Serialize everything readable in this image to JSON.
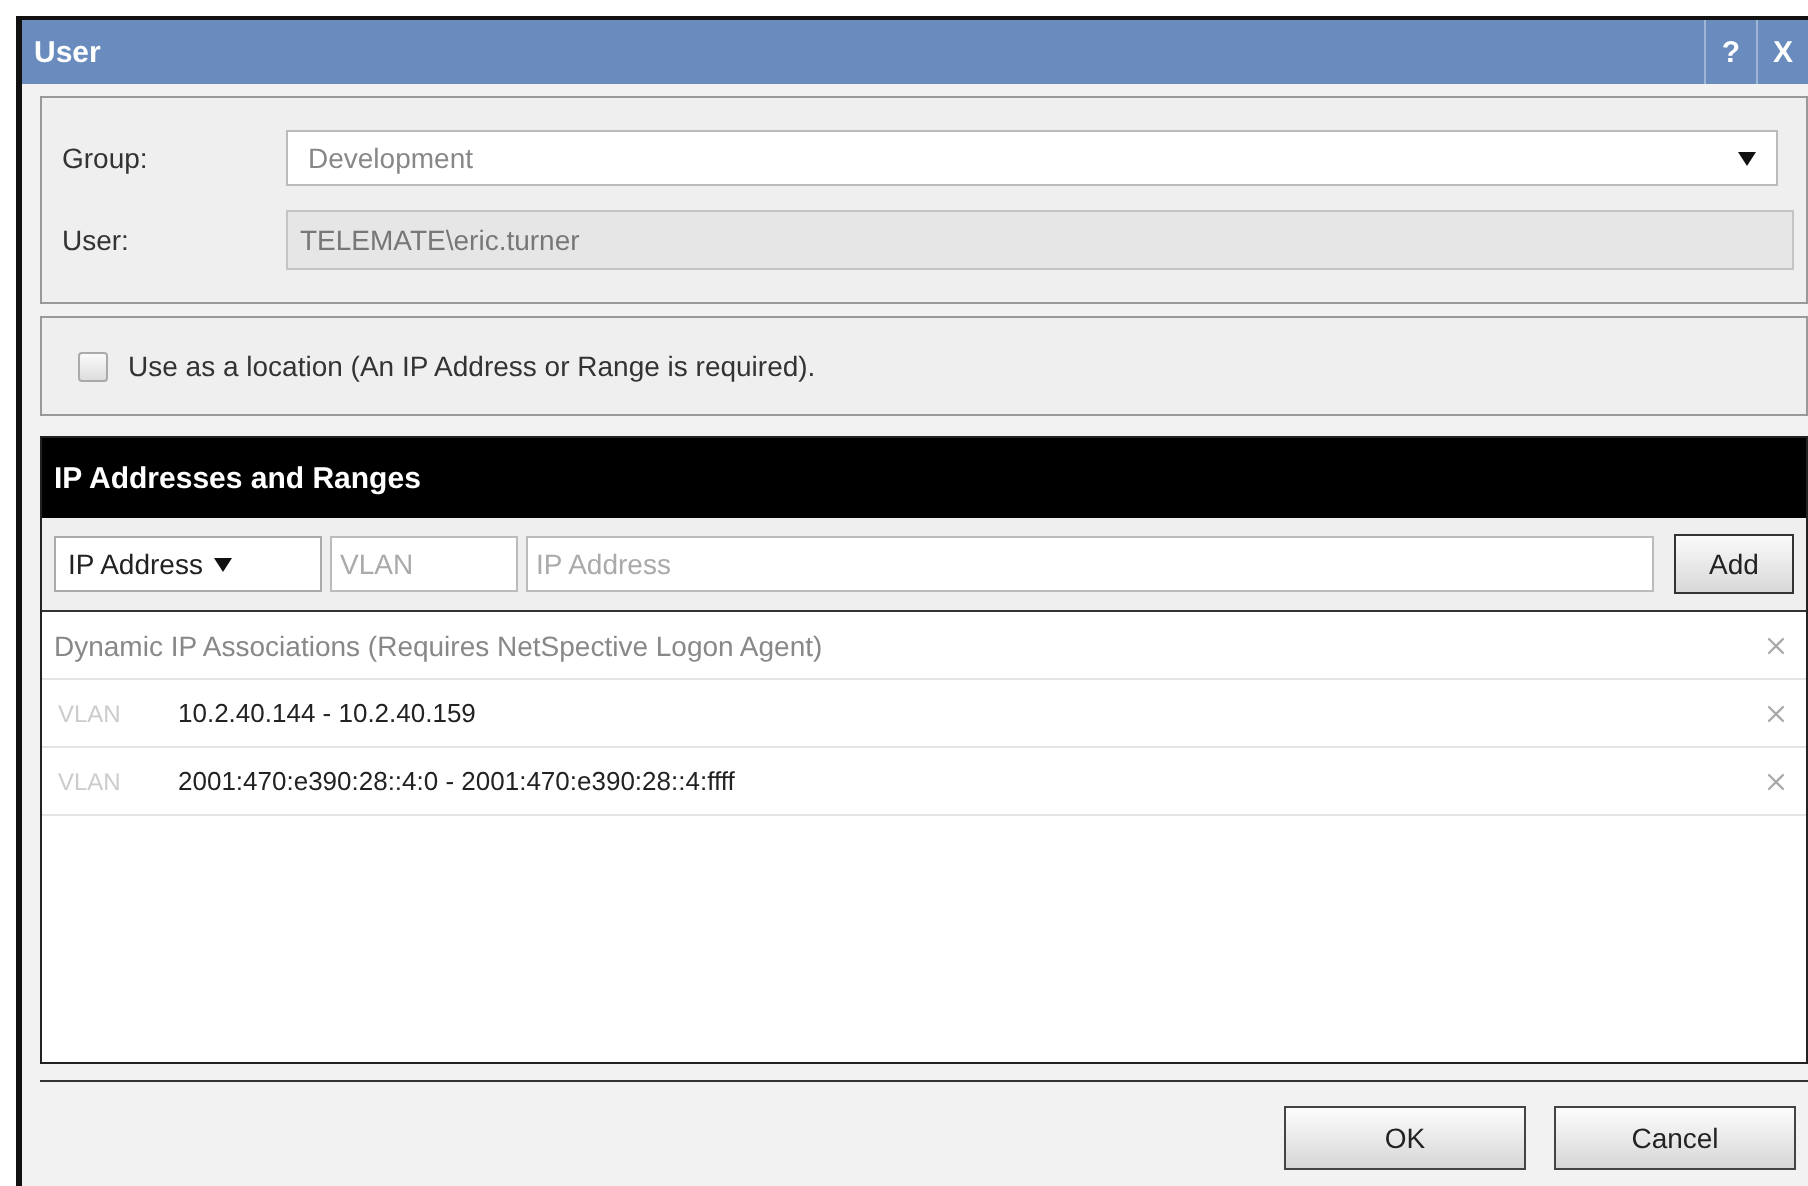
{
  "window": {
    "title": "User",
    "help": "?",
    "close": "X"
  },
  "fields": [
    {
      "kind": "select",
      "label": "Group:",
      "value": "Development"
    },
    {
      "kind": "readonly",
      "label": "User:",
      "value": "TELEMATE\\eric.turner"
    }
  ],
  "location": {
    "label": "Use as a location (An IP Address or Range is required).",
    "checked": false
  },
  "ip_section": {
    "title": "IP Addresses and Ranges",
    "type_select": "IP Address",
    "vlan_placeholder": "VLAN",
    "address_placeholder": "IP Address",
    "add_button": "Add",
    "rows": [
      {
        "kind": "group",
        "text": "Dynamic IP Associations (Requires NetSpective Logon Agent)"
      },
      {
        "kind": "range",
        "vlan": "VLAN",
        "text": "10.2.40.144 - 10.2.40.159"
      },
      {
        "kind": "range",
        "vlan": "VLAN",
        "text": "2001:470:e390:28::4:0 - 2001:470:e390:28::4:ffff"
      }
    ]
  },
  "buttons": [
    "OK",
    "Cancel"
  ]
}
